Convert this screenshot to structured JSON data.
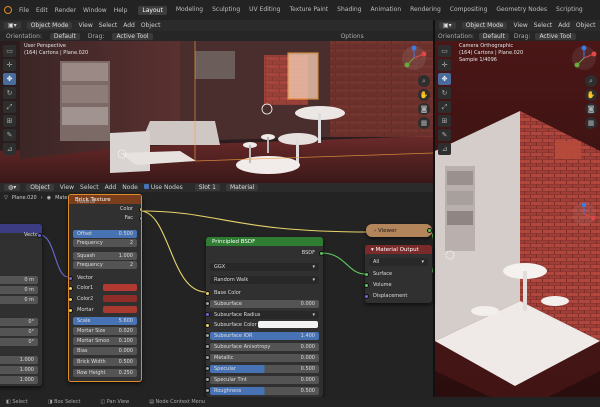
{
  "topbar": {
    "menus": [
      "File",
      "Edit",
      "Render",
      "Window",
      "Help"
    ],
    "workspaces": [
      "Layout",
      "Modeling",
      "Sculpting",
      "UV Editing",
      "Texture Paint",
      "Shading",
      "Animation",
      "Rendering",
      "Compositing",
      "Geometry Nodes",
      "Scripting"
    ],
    "active_workspace": "Layout"
  },
  "viewport_left": {
    "mode": "Object Mode",
    "menus": [
      "View",
      "Select",
      "Add",
      "Object"
    ],
    "orientation_label": "Orientation:",
    "orientation_value": "Default",
    "drag_label": "Drag:",
    "drag_value": "Active Tool",
    "options": "Options",
    "overlay_line1": "User Perspective",
    "overlay_line2": "(164) Cartons | Plane.020"
  },
  "viewport_right": {
    "mode": "Object Mode",
    "menus": [
      "View",
      "Select",
      "Add",
      "Object"
    ],
    "orientation_label": "Orientation:",
    "orientation_value": "Default",
    "drag_label": "Drag:",
    "drag_value": "Active Tool",
    "options": "Options",
    "overlay_line1": "Camera Orthographic",
    "overlay_line2": "(164) Cartons | Plane.020",
    "overlay_line3": "Sample 1/4096"
  },
  "node_editor": {
    "type_label": "Object",
    "menus": [
      "View",
      "Select",
      "Add",
      "Node"
    ],
    "use_nodes_label": "Use Nodes",
    "slot": "Slot 1",
    "material": "Material",
    "breadcrumb_object": "Plane.020",
    "breadcrumb_material": "Material"
  },
  "sidebar_left": {
    "vector_label": "Vector",
    "values": [
      "0 m",
      "0 m",
      "0 m",
      "0°",
      "0°",
      "0°",
      "1.000",
      "1.000",
      "1.000"
    ]
  },
  "brick_node": {
    "title": "Brick Texture",
    "sub": "Material",
    "out_color": "Color",
    "out_fac": "Fac",
    "offset_label": "Offset",
    "offset_value": "0.500",
    "frequency_label": "Frequency",
    "frequency_value": "2",
    "squash_label": "Squash",
    "squash_value": "1.000",
    "squash_freq_label": "Frequency",
    "squash_freq_value": "2",
    "vector": "Vector",
    "color1": "Color1",
    "color2": "Color2",
    "mortar": "Mortar",
    "scale_label": "Scale",
    "scale_value": "5.600",
    "mortar_size_label": "Mortar Size",
    "mortar_size_value": "0.020",
    "mortar_smooth_label": "Mortar Smoo",
    "mortar_smooth_value": "0.100",
    "bias_label": "Bias",
    "bias_value": "0.000",
    "brick_width_label": "Brick Width",
    "brick_width_value": "0.500",
    "row_height_label": "Row Height",
    "row_height_value": "0.250"
  },
  "bsdf_node": {
    "title": "Principled BSDF",
    "out_bsdf": "BSDF",
    "distribution": "GGX",
    "subsurface_method": "Random Walk",
    "base_color": "Base Color",
    "subsurface_label": "Subsurface",
    "subsurface_value": "0.000",
    "subsurface_radius": "Subsurface Radius",
    "subsurface_color": "Subsurface Color",
    "subsurface_ior_label": "Subsurface IOR",
    "subsurface_ior_value": "1.400",
    "subsurface_aniso_label": "Subsurface Anisotropy",
    "subsurface_aniso_value": "0.000",
    "metallic_label": "Metallic",
    "metallic_value": "0.000",
    "specular_label": "Specular",
    "specular_value": "0.500",
    "specular_tint_label": "Specular Tint",
    "specular_tint_value": "0.000",
    "roughness_label": "Roughness",
    "roughness_value": "0.500"
  },
  "viewer_node": {
    "title": "Viewer"
  },
  "output_node": {
    "title": "Material Output",
    "target": "All",
    "surface": "Surface",
    "volume": "Volume",
    "displacement": "Displacement"
  },
  "statusbar": {
    "select": "Select",
    "box_select": "Box Select",
    "pan_view": "Pan View",
    "context_menu": "Node Context Menu"
  },
  "colors": {
    "accent": "#e08a2a",
    "texture_header": "#7a3e1c",
    "shader_header": "#2e7d32",
    "viewer_header": "#b3855a",
    "output_header": "#7a2a2a",
    "blue_field": "#4772b3",
    "brick_red": "#b23a33"
  },
  "icons": [
    "blender-logo-icon",
    "select-box-icon",
    "cursor-icon",
    "move-icon",
    "rotate-icon",
    "scale-icon",
    "transform-icon",
    "annotate-icon",
    "measure-icon",
    "view-gizmo-icon",
    "zoom-icon",
    "hand-icon",
    "camera-icon",
    "grid-icon"
  ]
}
